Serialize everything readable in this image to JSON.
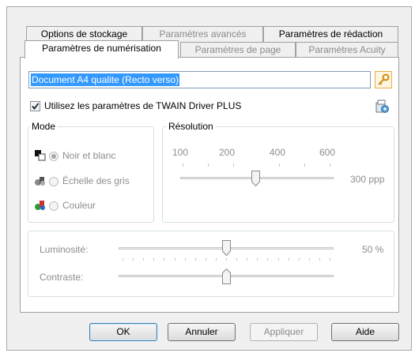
{
  "tabs_row1": [
    {
      "label": "Options de stockage",
      "enabled": true
    },
    {
      "label": "Paramètres avancés",
      "enabled": false
    },
    {
      "label": "Paramètres de rédaction",
      "enabled": true
    }
  ],
  "tabs_row2": [
    {
      "label": "Paramètres de numérisation",
      "selected": true,
      "enabled": true
    },
    {
      "label": "Paramètres de page",
      "enabled": false
    },
    {
      "label": "Paramètres Acuity",
      "enabled": false
    }
  ],
  "profile_name": "Document A4 qualite (Recto verso)",
  "twain": {
    "label": "Utilisez les paramètres de TWAIN Driver PLUS",
    "checked": true
  },
  "mode": {
    "title": "Mode",
    "options": [
      {
        "label": "Noir et blanc",
        "icon": "black-white-mode-icon",
        "selected": true
      },
      {
        "label": "Échelle des gris",
        "icon": "grayscale-mode-icon",
        "selected": false
      },
      {
        "label": "Couleur",
        "icon": "color-mode-icon",
        "selected": false
      }
    ]
  },
  "resolution": {
    "title": "Résolution",
    "ticks": [
      "100",
      "200",
      "400",
      "600"
    ],
    "value": 300,
    "unit_label": "300 ppp"
  },
  "brightness": {
    "label": "Luminosité:",
    "value_label": "50 %",
    "value": 50
  },
  "contrast": {
    "label": "Contraste:",
    "value": 50
  },
  "buttons": {
    "ok": "OK",
    "cancel": "Annuler",
    "apply": "Appliquer",
    "help": "Aide"
  },
  "colors": {
    "selection": "#3399ff",
    "accent_orange": "#f0a030"
  }
}
